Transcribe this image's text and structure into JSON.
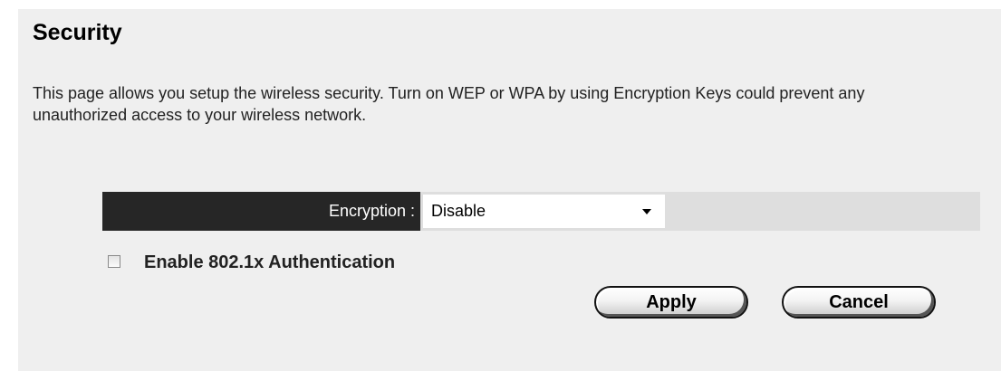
{
  "page": {
    "title": "Security",
    "description": "This page allows you setup the wireless security. Turn on WEP or WPA by using Encryption Keys could prevent any unauthorized access to your wireless network."
  },
  "form": {
    "encryption_label": "Encryption :",
    "encryption_value": "Disable",
    "auth_label": "Enable 802.1x Authentication",
    "auth_checked": false
  },
  "buttons": {
    "apply": "Apply",
    "cancel": "Cancel"
  },
  "colors": {
    "panel_background": "#efefef",
    "label_background": "#262626",
    "row_background": "#dedede"
  }
}
